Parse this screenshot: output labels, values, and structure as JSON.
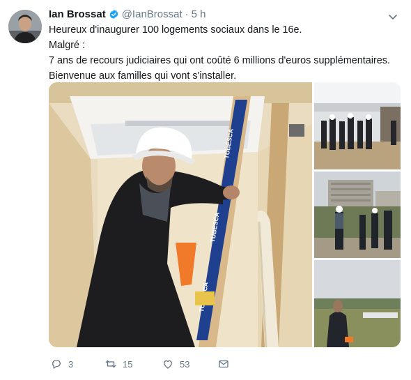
{
  "tweet": {
    "author_name": "Ian Brossat",
    "handle": "@IanBrossat",
    "separator": "·",
    "time": "5 h",
    "lines": [
      "Heureux d'inaugurer 100 logements sociaux dans le 16e.",
      "Malgré :",
      "7 ans de recours judiciaires qui ont coûté 6 millions d'euros supplémentaires.",
      "Bienvenue aux familles qui vont s'installer."
    ],
    "level_text": [
      "TUBESCA",
      "TUBESCA",
      "TUBESCA"
    ]
  },
  "actions": {
    "replies": "3",
    "retweets": "15",
    "likes": "53"
  },
  "colors": {
    "text": "#14171a",
    "muted": "#657786",
    "verified": "#1da1f2"
  },
  "icons": [
    "avatar",
    "verified-badge-icon",
    "chevron-down-icon",
    "reply-icon",
    "retweet-icon",
    "like-icon",
    "direct-message-icon"
  ]
}
